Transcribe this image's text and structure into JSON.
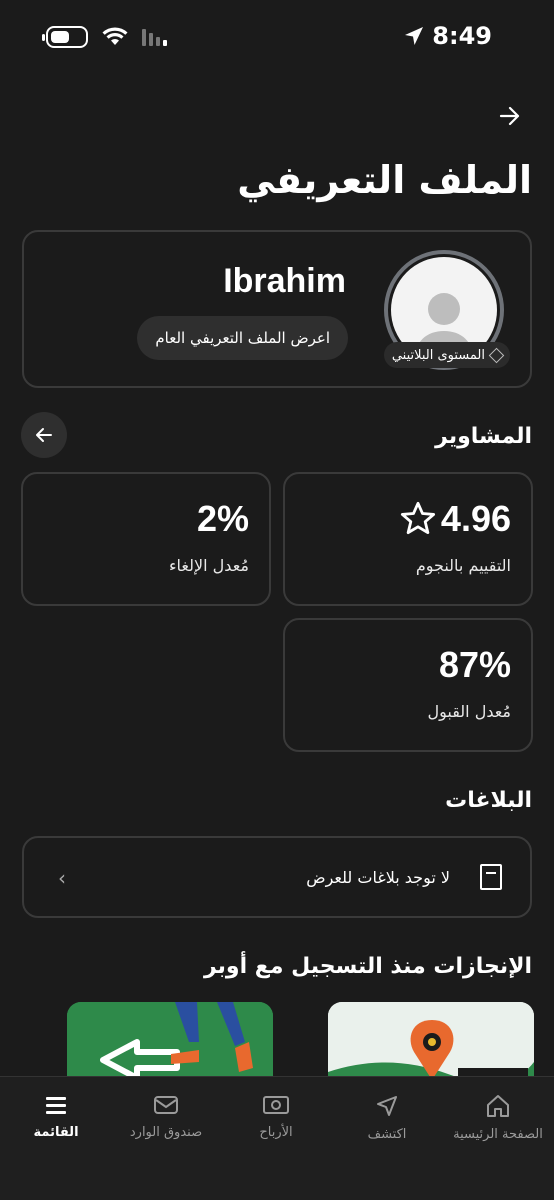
{
  "status_bar": {
    "time": "8:49"
  },
  "header": {
    "title": "الملف التعريفي"
  },
  "profile": {
    "name": "Ibrahim",
    "public_profile_button": "اعرض الملف التعريفي العام",
    "level": "المستوى البلاتيني"
  },
  "trips": {
    "title": "المشاوير",
    "stats": [
      {
        "value": "4.96",
        "label": "التقييم بالنجوم"
      },
      {
        "value": "2%",
        "label": "مُعدل الإلغاء"
      },
      {
        "value": "87%",
        "label": "مُعدل القبول"
      }
    ]
  },
  "reports": {
    "title": "البلاغات",
    "empty_text": "لا توجد بلاغات للعرض"
  },
  "achievements": {
    "title": "الإنجازات منذ التسجيل مع أوبر"
  },
  "nav": {
    "items": [
      {
        "label": "الصفحة الرئيسية",
        "icon": "home-icon"
      },
      {
        "label": "اكتشف",
        "icon": "compass-icon"
      },
      {
        "label": "الأرباح",
        "icon": "earnings-icon"
      },
      {
        "label": "صندوق الوارد",
        "icon": "inbox-icon"
      },
      {
        "label": "القائمة",
        "icon": "menu-icon"
      }
    ]
  },
  "colors": {
    "background": "#1b1b1b",
    "accent_green": "#2e8a4a",
    "accent_orange": "#e8692e"
  }
}
